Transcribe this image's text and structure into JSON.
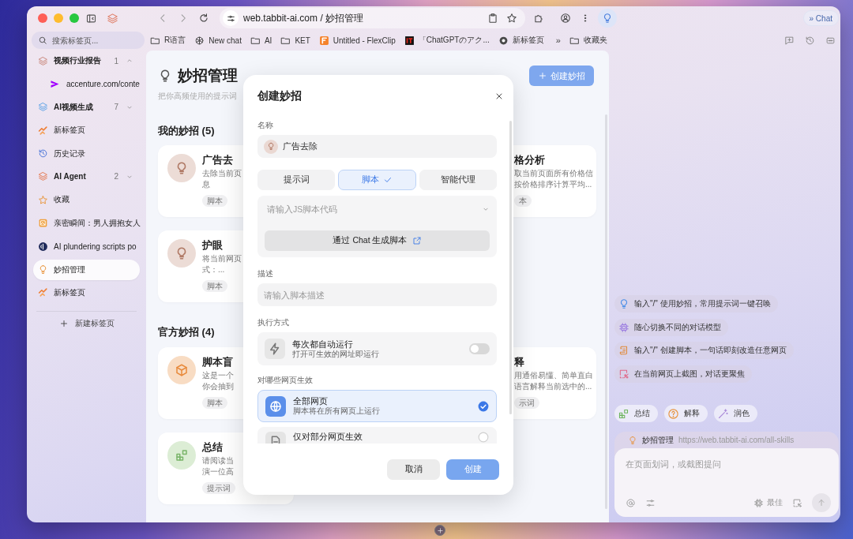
{
  "window": {
    "address": "web.tabbit-ai.com / 妙招管理",
    "chat_button": "» Chat"
  },
  "sidebar": {
    "search": {
      "placeholder": "搜索标签页..."
    },
    "items": [
      {
        "label": "视频行业报告",
        "kind": "group",
        "count": "1",
        "expanded": true,
        "selected": false,
        "children": [
          {
            "label": "accenture.com/conte",
            "selected": false
          }
        ]
      },
      {
        "label": "AI视频生成",
        "kind": "group",
        "count": "7",
        "expanded": false,
        "selected": false
      },
      {
        "label": "新标签页",
        "kind": "tab",
        "selected": false
      },
      {
        "label": "历史记录",
        "kind": "tab",
        "selected": false
      },
      {
        "label": "AI Agent",
        "kind": "group",
        "count": "2",
        "expanded": false,
        "selected": false
      },
      {
        "label": "收藏",
        "kind": "tab",
        "selected": false
      },
      {
        "label": "亲密瞬间：男人拥抱女人",
        "kind": "tab",
        "selected": false
      },
      {
        "label": "AI plundering scripts po",
        "kind": "tab",
        "selected": false
      },
      {
        "label": "妙招管理",
        "kind": "tab",
        "selected": true
      },
      {
        "label": "新标签页",
        "kind": "tab",
        "selected": false
      }
    ],
    "new_tab": "新建标签页"
  },
  "bookmarks": [
    {
      "label": "R语言",
      "kind": "folder"
    },
    {
      "label": "New chat",
      "kind": "chat"
    },
    {
      "label": "AI",
      "kind": "folder"
    },
    {
      "label": "KET",
      "kind": "folder"
    },
    {
      "label": "Untitled - FlexClip",
      "kind": "flexclip"
    },
    {
      "label": "「ChatGPTのアク...",
      "kind": "it"
    },
    {
      "label": "新标签页",
      "kind": "chrome"
    }
  ],
  "bookmarks_more": "»",
  "bookmarks_folder": "收藏夹",
  "page": {
    "title": "妙招管理",
    "subtitle": "把你高频使用的提示词",
    "create_button": "创建妙招",
    "sections": [
      {
        "title": "我的妙招 (5)",
        "cards": [
          {
            "title": "广告去",
            "lines": [
              "去除当前页",
              "息"
            ],
            "tag": "脚本"
          },
          {
            "title": "格分析",
            "lines": [
              "取当前页面所有价格信",
              "按价格排序计算平均..."
            ],
            "tag": "本"
          },
          {
            "title": "护眼",
            "lines": [
              "将当前网页",
              "式：..."
            ],
            "tag": "脚本"
          }
        ]
      },
      {
        "title": "官方妙招 (4)",
        "cards": [
          {
            "title": "脚本盲",
            "lines": [
              "这是一个",
              "你会抽到"
            ],
            "tag": "脚本"
          },
          {
            "title": "释",
            "lines": [
              "用通俗易懂、简单直白",
              "语言解释当前选中的..."
            ],
            "tag": "示词"
          },
          {
            "title": "总结",
            "lines": [
              "请阅读当",
              "演一位高"
            ],
            "tag": "提示词"
          }
        ]
      }
    ]
  },
  "modal": {
    "title": "创建妙招",
    "name_label": "名称",
    "name_value": "广告去除",
    "type_tabs": [
      {
        "label": "提示词",
        "selected": false
      },
      {
        "label": "脚本",
        "selected": true
      },
      {
        "label": "智能代理",
        "selected": false
      }
    ],
    "code": {
      "placeholder": "请输入JS脚本代码"
    },
    "generate_button": "通过 Chat 生成脚本",
    "description_label": "描述",
    "description": {
      "placeholder": "请输入脚本描述"
    },
    "run_label": "执行方式",
    "auto_run": {
      "title": "每次都自动运行",
      "subtitle": "打开可生效的网址即运行",
      "on": false
    },
    "scope_label": "对哪些网页生效",
    "scope_options": [
      {
        "title": "全部网页",
        "subtitle": "脚本将在所有网页上运行",
        "selected": true
      },
      {
        "title": "仅对部分网页生效",
        "selected": false
      }
    ],
    "cancel_button": "取消",
    "confirm_button": "创建"
  },
  "chat": {
    "suggestions": [
      "输入\"/\" 使用妙招，常用提示词一键召唤",
      "随心切换不同的对话模型",
      "输入\"/\" 创建脚本，一句话即刻改造任意网页",
      "在当前网页上截图，对话更聚焦"
    ],
    "quick_actions": [
      "总结",
      "解释",
      "润色"
    ],
    "context": {
      "title": "妙招管理",
      "url": "https://web.tabbit-ai.com/all-skills"
    },
    "input": {
      "placeholder": "在页面划词，或截图提问"
    },
    "model": "最佳"
  }
}
